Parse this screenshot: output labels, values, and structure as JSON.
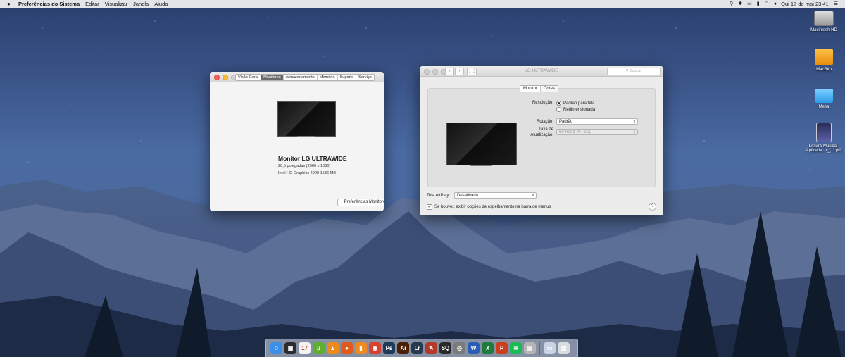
{
  "menubar": {
    "app_name": "Preferências do Sistema",
    "menus": [
      "Editar",
      "Visualizar",
      "Janela",
      "Ajuda"
    ],
    "status_icons": [
      "spotlight-icon",
      "bluetooth-icon",
      "airplay-icon",
      "battery-icon",
      "wifi-icon",
      "volume-icon",
      "user-icon"
    ],
    "clock": "Qui 17 de mai  23:41"
  },
  "desktop_icons": [
    {
      "label": "Macintosh HD",
      "icon": "hard-drive-icon"
    },
    {
      "label": "MacBkp",
      "icon": "external-drive-icon"
    },
    {
      "label": "Mesa",
      "icon": "folder-icon"
    },
    {
      "label": "Leitura-Musical-Aplicada...r_(1).pdf",
      "icon": "pdf-file-icon"
    }
  ],
  "about_window": {
    "tabs": [
      "Visão Geral",
      "Monitores",
      "Armazenamento",
      "Memória",
      "Suporte",
      "Serviço"
    ],
    "active_tab": "Monitores",
    "monitor_name": "Monitor LG ULTRAWIDE",
    "size_line": "28,5 polegadas (2560 x 1080)",
    "graphics_line": "Intel HD Graphics 4000 1536 MB",
    "display_prefs_button": "Preferências Monitores..."
  },
  "prefs_window": {
    "title": "LG ULTRAWIDE",
    "search_placeholder": "Buscar",
    "tabs": [
      "Monitor",
      "Cores"
    ],
    "resolution_label": "Resolução:",
    "resolution_options": [
      "Padrão para tela",
      "Redimensionada"
    ],
    "resolution_selected": "Padrão para tela",
    "rotation_label": "Rotação:",
    "rotation_value": "Padrão",
    "refresh_label_1": "Taxa de",
    "refresh_label_2": "Atualização:",
    "refresh_value": "60 Hertz (NTSC)",
    "airplay_label": "Tela AirPlay:",
    "airplay_value": "Desativada",
    "mirroring_checkbox": "Se houver, exibir opções de espelhamento na barra de menus",
    "mirroring_checked": true,
    "help": "?"
  },
  "dock": [
    {
      "name": "finder",
      "glyph": "☺",
      "color": "#3b8fe6"
    },
    {
      "name": "activity-monitor",
      "glyph": "▦",
      "color": "#2b2b2b"
    },
    {
      "name": "calendar",
      "glyph": "17",
      "color": "#f3f3f3"
    },
    {
      "name": "utorrent",
      "glyph": "µ",
      "color": "#5fae2f"
    },
    {
      "name": "vlc",
      "glyph": "▲",
      "color": "#ef8a1a"
    },
    {
      "name": "firefox",
      "glyph": "●",
      "color": "#e05a1c"
    },
    {
      "name": "ibooks",
      "glyph": "▮",
      "color": "#f08a1c"
    },
    {
      "name": "chrome",
      "glyph": "◉",
      "color": "#d8412f"
    },
    {
      "name": "photoshop",
      "glyph": "Ps",
      "color": "#1f3a57"
    },
    {
      "name": "illustrator",
      "glyph": "Ai",
      "color": "#4a1f06"
    },
    {
      "name": "lightroom",
      "glyph": "Lr",
      "color": "#253a4d"
    },
    {
      "name": "scrivener",
      "glyph": "✎",
      "color": "#b33a2a"
    },
    {
      "name": "sq-app",
      "glyph": "SQ",
      "color": "#2a2a2a"
    },
    {
      "name": "disk-utility",
      "glyph": "◎",
      "color": "#7a7a7a"
    },
    {
      "name": "word",
      "glyph": "W",
      "color": "#2b5fb4"
    },
    {
      "name": "excel",
      "glyph": "X",
      "color": "#1e7a3e"
    },
    {
      "name": "powerpoint",
      "glyph": "P",
      "color": "#cc3f1e"
    },
    {
      "name": "spotify",
      "glyph": "≋",
      "color": "#1db954"
    },
    {
      "name": "preview",
      "glyph": "▤",
      "color": "#b5b5b5"
    },
    {
      "name": "downloads",
      "glyph": "▭",
      "color": "#c8d4e6"
    },
    {
      "name": "trash",
      "glyph": "▥",
      "color": "#d9dce0"
    }
  ]
}
